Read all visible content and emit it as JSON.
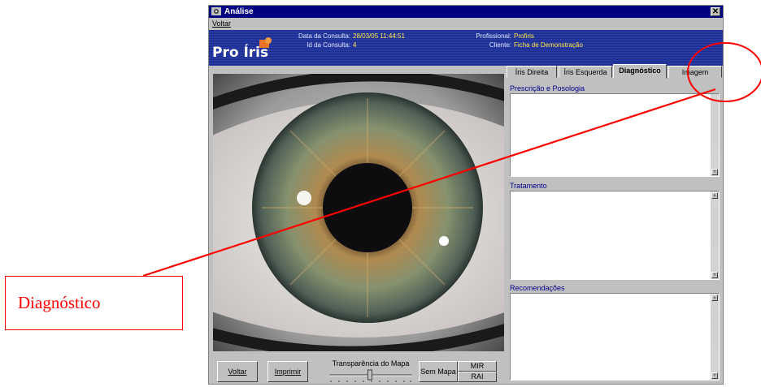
{
  "window": {
    "title": "Análise",
    "close_symbol": "✕",
    "menu": [
      "Voltar"
    ]
  },
  "header": {
    "logo": "Pro Íris",
    "data_label": "Data da Consulta:",
    "data_value": "28/03/05 11:44:51",
    "id_label": "Id da Consulta:",
    "id_value": "4",
    "prof_label": "Profissional:",
    "prof_value": "Profiris",
    "cliente_label": "Cliente:",
    "cliente_value": "Ficha de Demonstração",
    "value_color": "#ffe84a"
  },
  "tabs": [
    {
      "label": "Íris Direita",
      "active": false
    },
    {
      "label": "Íris Esquerda",
      "active": false
    },
    {
      "label": "Diagnóstico",
      "active": true
    },
    {
      "label": "Imagem",
      "active": false
    }
  ],
  "sections": {
    "prescricao_label": "Prescrição e Posologia",
    "tratamento_label": "Tratamento",
    "recomendacoes_label": "Recomendações"
  },
  "bottom": {
    "voltar": "Voltar",
    "imprimir": "Imprimir",
    "transparencia_label": "Transparência do Mapa",
    "transparencia_level": 0.5,
    "sem_mapa": "Sem Mapa",
    "mir": "MIR",
    "rai": "RAI"
  },
  "annotation": {
    "callout_text": "Diagnóstico",
    "color": "#ff0000"
  }
}
